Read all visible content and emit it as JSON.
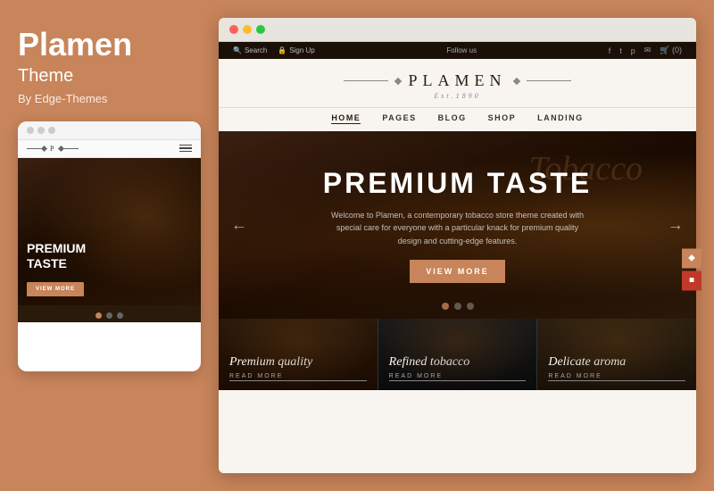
{
  "left": {
    "title": "Plamen",
    "subtitle": "Theme",
    "by": "By Edge-Themes",
    "mobile": {
      "logo": "P",
      "headline_line1": "PREMIUM",
      "headline_line2": "TASTE",
      "cta": "VIEW MORE",
      "dots": [
        "active",
        "inactive",
        "inactive"
      ]
    }
  },
  "website": {
    "topbar": {
      "left_items": [
        "Search",
        "Sign Up"
      ],
      "center": "Follow us",
      "right_items": [
        "envelope-icon",
        "cart-icon",
        "(0)"
      ]
    },
    "logo": {
      "text": "PLAMEN",
      "est": "Est.1890"
    },
    "nav": {
      "items": [
        "HOME",
        "PAGES",
        "BLOG",
        "SHOP",
        "LANDING"
      ],
      "active": "HOME"
    },
    "hero": {
      "script_text": "Tobacco",
      "title": "PREMIUM TASTE",
      "subtitle": "Welcome to Plamen, a contemporary tobacco store theme created with special care for everyone with a particular knack for premium quality design and cutting-edge features.",
      "cta": "VIEW MORE",
      "prev_arrow": "←",
      "next_arrow": "→"
    },
    "features": [
      {
        "title": "Premium quality",
        "link": "READ MORE"
      },
      {
        "title": "Refined tobacco",
        "link": "READ MORE"
      },
      {
        "title": "Delicate aroma",
        "link": "READ MORE"
      }
    ]
  }
}
